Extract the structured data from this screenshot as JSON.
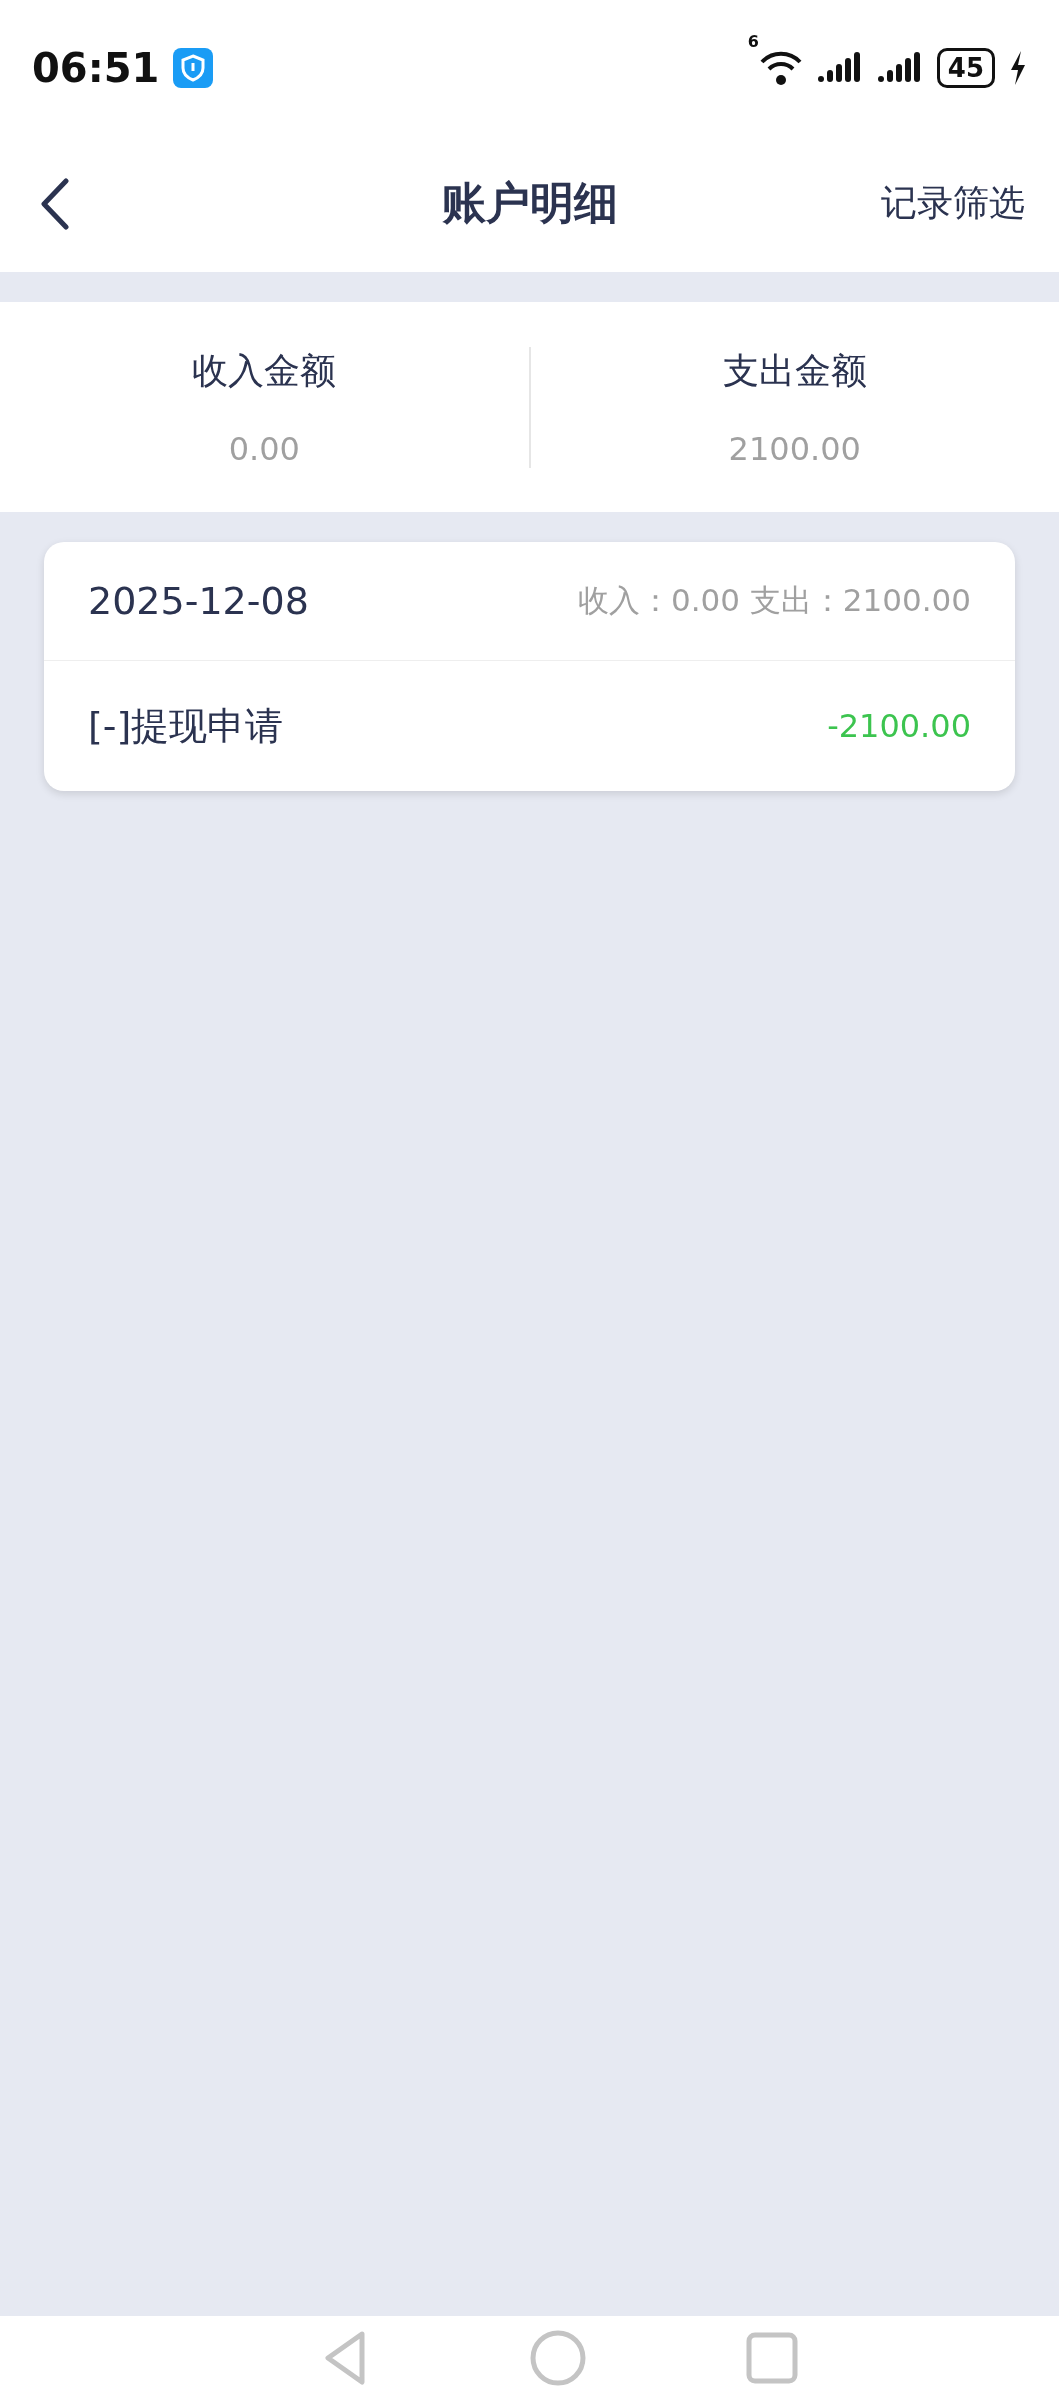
{
  "status_bar": {
    "time": "06:51",
    "wifi_badge": "6",
    "battery": "45",
    "charging": true
  },
  "header": {
    "title": "账户明细",
    "action": "记录筛选"
  },
  "summary": [
    {
      "label": "收入金额",
      "value": "0.00"
    },
    {
      "label": "支出金额",
      "value": "2100.00"
    }
  ],
  "groups": [
    {
      "date": "2025-12-08",
      "totals": "收入：0.00 支出：2100.00",
      "records": [
        {
          "title": "[-]提现申请",
          "amount": "-2100.00",
          "kind": "expense"
        }
      ]
    }
  ]
}
